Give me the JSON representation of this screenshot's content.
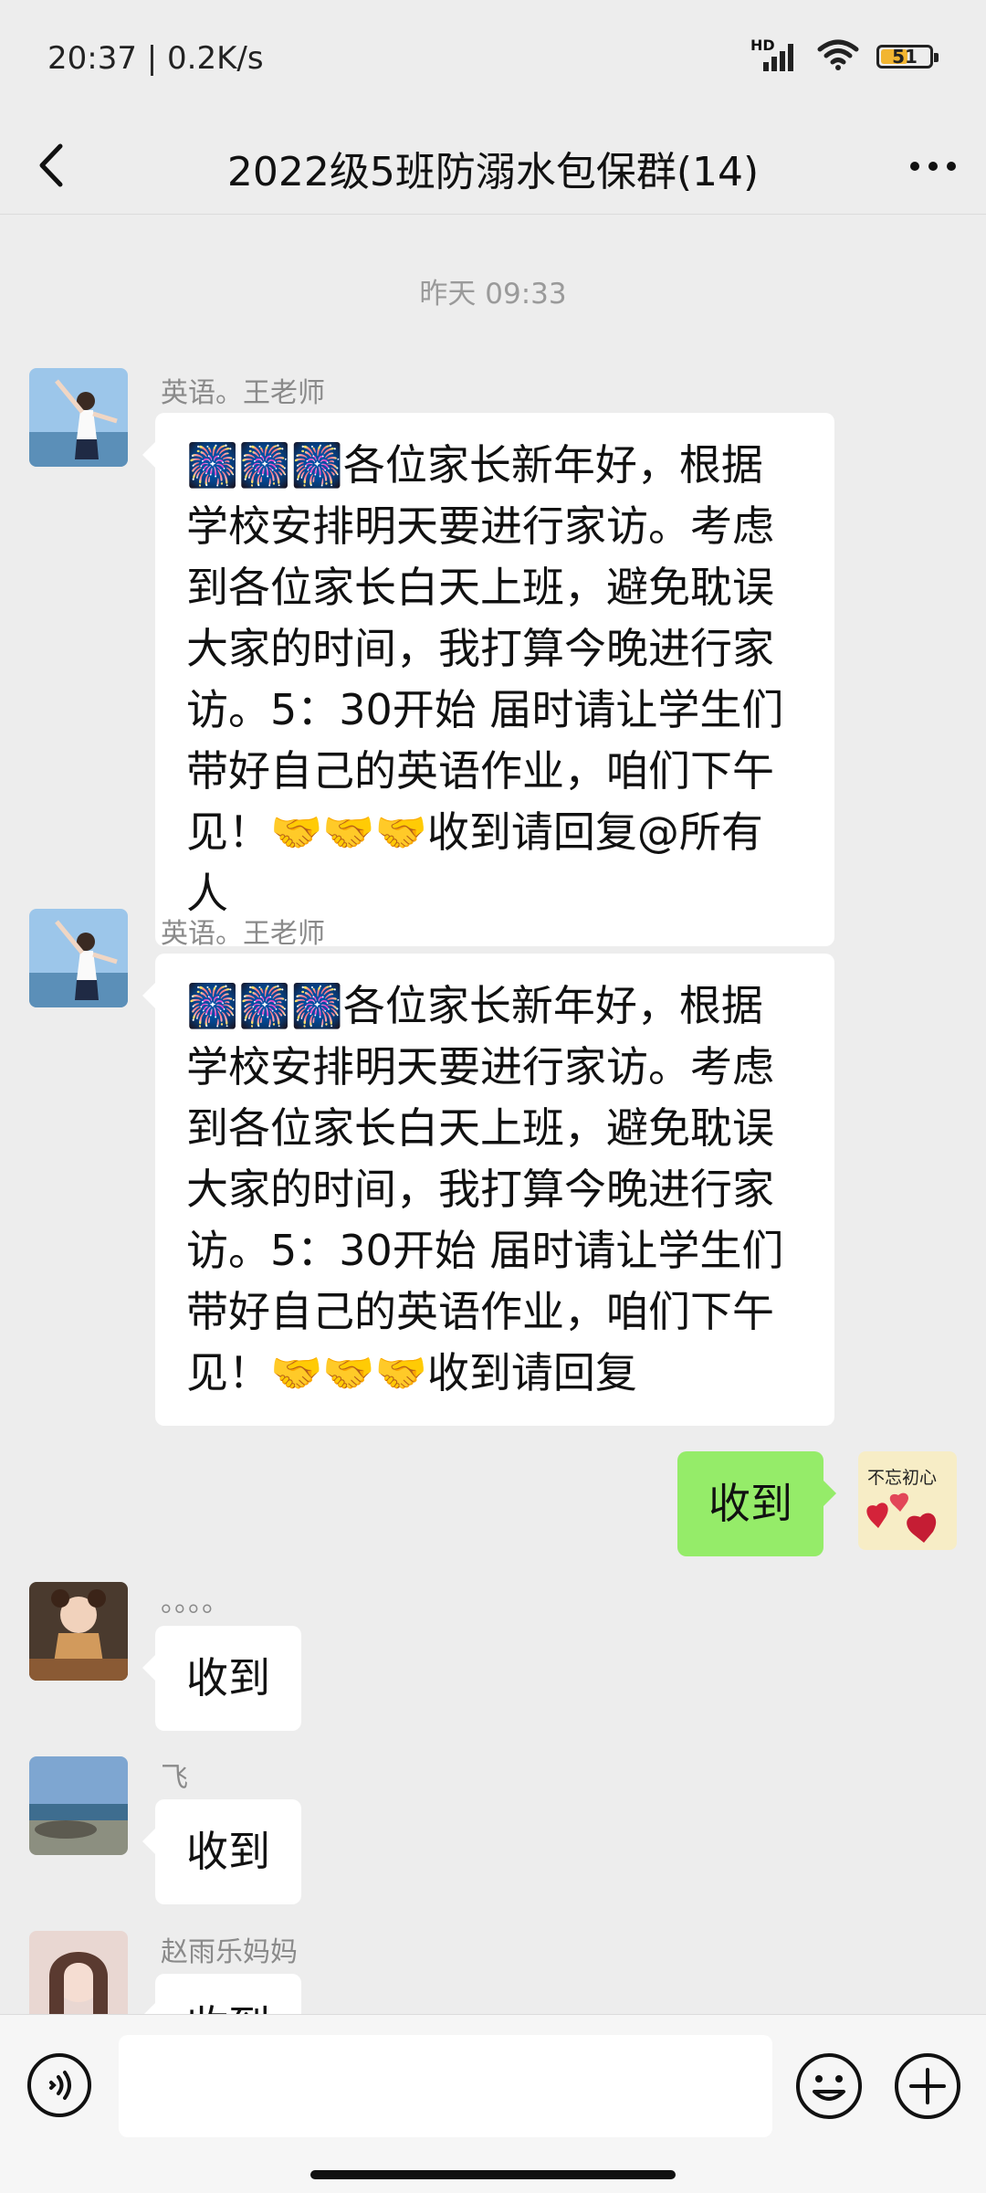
{
  "status_bar": {
    "time_net": "20:37 | 0.2K/s",
    "battery": "51",
    "network_label": "HD"
  },
  "nav": {
    "title": "2022级5班防溺水包保群(14)"
  },
  "chat": {
    "timestamp": "昨天 09:33",
    "messages": [
      {
        "sender": "英语。王老师",
        "text": "🎆🎆🎆各位家长新年好，根据学校安排明天要进行家访。考虑到各位家长白天上班，避免耽误大家的时间，我打算今晚进行家访。5：30开始  届时请让学生们带好自己的英语作业，咱们下午见！🤝🤝🤝收到请回复@所有人"
      },
      {
        "sender": "英语。王老师",
        "text": "🎆🎆🎆各位家长新年好，根据学校安排明天要进行家访。考虑到各位家长白天上班，避免耽误大家的时间，我打算今晚进行家访。5：30开始  届时请让学生们带好自己的英语作业，咱们下午见！🤝🤝🤝收到请回复"
      },
      {
        "sender": "",
        "text": "收到",
        "mine": true,
        "avatar_text": "不忘初心"
      },
      {
        "sender": "。。。。",
        "text": "收到"
      },
      {
        "sender": "飞",
        "text": "收到"
      },
      {
        "sender": "赵雨乐妈妈",
        "text": "收到"
      }
    ]
  },
  "input_bar": {
    "placeholder": ""
  },
  "colors": {
    "background": "#ededed",
    "my_bubble": "#95ec69",
    "other_bubble": "#ffffff"
  }
}
